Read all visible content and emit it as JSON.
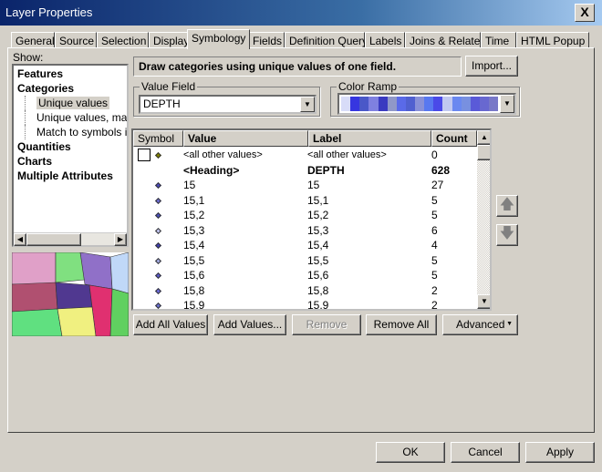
{
  "window": {
    "title": "Layer Properties",
    "close": "X"
  },
  "tabs": [
    "General",
    "Source",
    "Selection",
    "Display",
    "Symbology",
    "Fields",
    "Definition Query",
    "Labels",
    "Joins & Relates",
    "Time",
    "HTML Popup"
  ],
  "active_tab": "Symbology",
  "show": {
    "label": "Show:",
    "items": [
      {
        "label": "Features",
        "bold": true
      },
      {
        "label": "Categories",
        "bold": true
      },
      {
        "label": "Unique values",
        "sub": true,
        "selected": true
      },
      {
        "label": "Unique values, many fields",
        "sub": true
      },
      {
        "label": "Match to symbols in a style",
        "sub": true
      },
      {
        "label": "Quantities",
        "bold": true
      },
      {
        "label": "Charts",
        "bold": true
      },
      {
        "label": "Multiple Attributes",
        "bold": true
      }
    ]
  },
  "description": "Draw categories using unique values of one field.",
  "import_label": "Import...",
  "value_field": {
    "label": "Value Field",
    "value": "DEPTH"
  },
  "color_ramp": {
    "label": "Color Ramp",
    "colors": [
      "#d8dcf8",
      "#3636e0",
      "#4a58c8",
      "#7f80e0",
      "#3a3ac0",
      "#9098c8",
      "#5a6ae8",
      "#5060d0",
      "#8890d8",
      "#5878f0",
      "#4a4ae8",
      "#c0c8f0",
      "#6a88f0",
      "#7890e0",
      "#5a5ad8",
      "#6868d0",
      "#7878c8"
    ]
  },
  "table": {
    "headers": [
      "Symbol",
      "Value",
      "Label",
      "Count"
    ],
    "rows": [
      {
        "value": "<all other values>",
        "label": "<all other values>",
        "count": "0",
        "color": "#808000",
        "checkbox": true
      },
      {
        "value": "<Heading>",
        "label": "DEPTH",
        "count": "628",
        "heading": true
      },
      {
        "value": "15",
        "label": "15",
        "count": "27",
        "color": "#4a4ab8"
      },
      {
        "value": "15,1",
        "label": "15,1",
        "count": "5",
        "color": "#6a6ad0"
      },
      {
        "value": "15,2",
        "label": "15,2",
        "count": "5",
        "color": "#4a50b8"
      },
      {
        "value": "15,3",
        "label": "15,3",
        "count": "6",
        "color": "#c0c4f0"
      },
      {
        "value": "15,4",
        "label": "15,4",
        "count": "4",
        "color": "#4040b0"
      },
      {
        "value": "15,5",
        "label": "15,5",
        "count": "5",
        "color": "#a0a8e0"
      },
      {
        "value": "15,6",
        "label": "15,6",
        "count": "5",
        "color": "#5a5ac8"
      },
      {
        "value": "15,8",
        "label": "15,8",
        "count": "2",
        "color": "#6a6ad8"
      },
      {
        "value": "15,9",
        "label": "15,9",
        "count": "2",
        "color": "#6a70d0"
      }
    ]
  },
  "buttons": {
    "add_all": "Add All Values",
    "add": "Add Values...",
    "remove": "Remove",
    "remove_all": "Remove All",
    "advanced": "Advanced"
  },
  "footer": {
    "ok": "OK",
    "cancel": "Cancel",
    "apply": "Apply"
  }
}
